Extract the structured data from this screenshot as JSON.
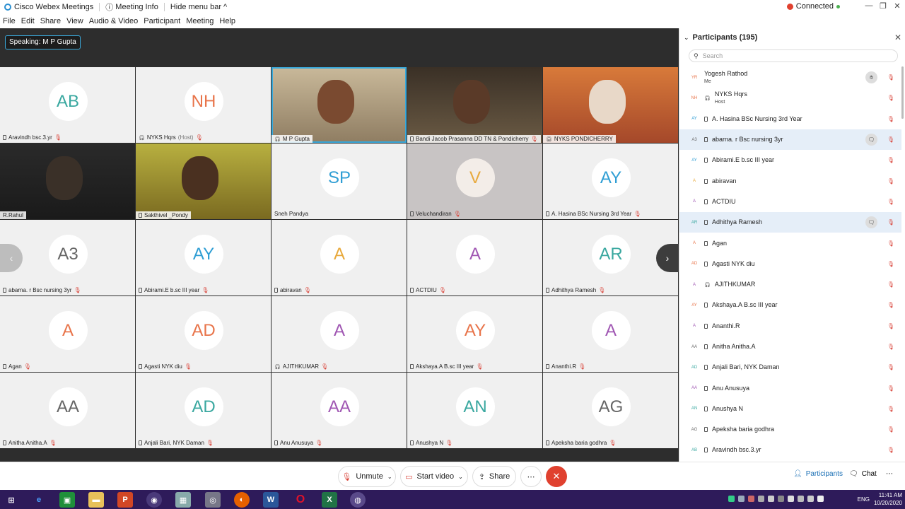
{
  "titlebar": {
    "app": "Cisco Webex Meetings",
    "meeting_info": "Meeting Info",
    "hide_menu": "Hide menu bar",
    "status": "Connected"
  },
  "menu": [
    "File",
    "Edit",
    "Share",
    "View",
    "Audio & Video",
    "Participant",
    "Meeting",
    "Help"
  ],
  "speaking": "Speaking: M P Gupta",
  "tiles": [
    {
      "initials": "AB",
      "name": "Aravindh bsc.3.yr",
      "color": "#3aa8a0",
      "icon": "phone",
      "mic": true
    },
    {
      "initials": "NH",
      "name": "NYKS Hqrs",
      "suffix": "(Host)",
      "color": "#e8744a",
      "icon": "headset-phone",
      "mic": true
    },
    {
      "video": true,
      "name": "M P Gupta",
      "icon": "headset",
      "active": true
    },
    {
      "video": true,
      "name": "Bandi Jacob Prasanna DD TN & Pondicherry",
      "icon": "phone",
      "mic": true
    },
    {
      "video": true,
      "name": "NYKS PONDICHERRY",
      "icon": "headset"
    },
    {
      "video": true,
      "name": "R.Rahul"
    },
    {
      "video": true,
      "name": "Sakthivel _Pondy",
      "icon": "phone",
      "warn": true
    },
    {
      "initials": "SP",
      "name": "Sneh Pandya",
      "color": "#2f9ed4"
    },
    {
      "initials": "V",
      "name": "Veluchandiran",
      "color": "#e8a93c",
      "icon": "phone",
      "mic": true,
      "dim": true
    },
    {
      "initials": "AY",
      "name": "A. Hasina BSc Nursing 3rd Year",
      "color": "#2f9ed4",
      "icon": "phone",
      "mic": true
    },
    {
      "initials": "A3",
      "name": "abarna. r Bsc nursing 3yr",
      "color": "#666",
      "icon": "phone",
      "mic": true
    },
    {
      "initials": "AY",
      "name": "Abirami.E b.sc III year",
      "color": "#2f9ed4",
      "icon": "phone",
      "mic": true
    },
    {
      "initials": "A",
      "name": "abiravan",
      "color": "#e8a93c",
      "icon": "phone",
      "mic": true
    },
    {
      "initials": "A",
      "name": "ACTDIU",
      "color": "#a057b3",
      "icon": "phone",
      "mic": true
    },
    {
      "initials": "AR",
      "name": "Adhithya Ramesh",
      "color": "#3aa8a0",
      "icon": "phone",
      "mic": true
    },
    {
      "initials": "A",
      "name": "Agan",
      "color": "#e8744a",
      "icon": "phone",
      "mic": true
    },
    {
      "initials": "AD",
      "name": "Agasti NYK diu",
      "color": "#e8744a",
      "icon": "phone",
      "mic": true
    },
    {
      "initials": "A",
      "name": "AJITHKUMAR",
      "color": "#a057b3",
      "icon": "headset",
      "mic": true
    },
    {
      "initials": "AY",
      "name": "Akshaya.A B.sc III year",
      "color": "#e8744a",
      "icon": "phone",
      "mic": true
    },
    {
      "initials": "A",
      "name": "Ananthi.R",
      "color": "#a057b3",
      "icon": "phone",
      "mic": true
    },
    {
      "initials": "AA",
      "name": "Anitha Anitha.A",
      "color": "#666",
      "icon": "phone",
      "mic": true
    },
    {
      "initials": "AD",
      "name": "Anjali Bari, NYK Daman",
      "color": "#3aa8a0",
      "icon": "phone",
      "mic": true
    },
    {
      "initials": "AA",
      "name": "Anu Anusuya",
      "color": "#a057b3",
      "icon": "phone",
      "mic": true
    },
    {
      "initials": "AN",
      "name": "Anushya N",
      "color": "#3aa8a0",
      "icon": "phone",
      "mic": true
    },
    {
      "initials": "AG",
      "name": "Apeksha baria godhra",
      "color": "#666",
      "icon": "phone",
      "mic": true
    }
  ],
  "panel": {
    "title": "Participants (195)",
    "search_placeholder": "Search",
    "people": [
      {
        "initials": "YR",
        "name": "Yogesh Rathod",
        "sub": "Me",
        "color": "#e8744a",
        "raise": true
      },
      {
        "initials": "NH",
        "name": "NYKS Hqrs",
        "sub": "Host",
        "color": "#e8744a",
        "icon": "headset"
      },
      {
        "initials": "AY",
        "name": "A. Hasina BSc Nursing 3rd Year",
        "color": "#2f9ed4",
        "icon": "phone"
      },
      {
        "initials": "A3",
        "name": "abarna. r Bsc nursing 3yr",
        "color": "#666",
        "icon": "phone",
        "sel": true
      },
      {
        "initials": "AY",
        "name": "Abirami.E b.sc III year",
        "color": "#2f9ed4",
        "icon": "phone"
      },
      {
        "initials": "A",
        "name": "abiravan",
        "color": "#e8a93c",
        "icon": "phone"
      },
      {
        "initials": "A",
        "name": "ACTDIU",
        "color": "#a057b3",
        "icon": "phone"
      },
      {
        "initials": "AR",
        "name": "Adhithya Ramesh",
        "color": "#3aa8a0",
        "icon": "phone",
        "sel": true
      },
      {
        "initials": "A",
        "name": "Agan",
        "color": "#e8744a",
        "icon": "phone"
      },
      {
        "initials": "AD",
        "name": "Agasti NYK diu",
        "color": "#e8744a",
        "icon": "phone"
      },
      {
        "initials": "A",
        "name": "AJITHKUMAR",
        "color": "#a057b3",
        "icon": "headset"
      },
      {
        "initials": "AY",
        "name": "Akshaya.A B.sc III year",
        "color": "#e8744a",
        "icon": "phone"
      },
      {
        "initials": "A",
        "name": "Ananthi.R",
        "color": "#a057b3",
        "icon": "phone"
      },
      {
        "initials": "AA",
        "name": "Anitha Anitha.A",
        "color": "#666",
        "icon": "phone"
      },
      {
        "initials": "AD",
        "name": "Anjali Bari, NYK Daman",
        "color": "#3aa8a0",
        "icon": "phone"
      },
      {
        "initials": "AA",
        "name": "Anu Anusuya",
        "color": "#a057b3",
        "icon": "phone"
      },
      {
        "initials": "AN",
        "name": "Anushya N",
        "color": "#3aa8a0",
        "icon": "phone"
      },
      {
        "initials": "AG",
        "name": "Apeksha baria godhra",
        "color": "#666",
        "icon": "phone"
      },
      {
        "initials": "AB",
        "name": "Aravindh bsc.3.yr",
        "color": "#3aa8a0",
        "icon": "phone"
      }
    ]
  },
  "controls": {
    "unmute": "Unmute",
    "start_video": "Start video",
    "share": "Share",
    "more": "⋯",
    "participants": "Participants",
    "chat": "Chat"
  },
  "taskbar": {
    "lang": "ENG",
    "time": "11:41 AM",
    "date": "10/20/2020"
  }
}
